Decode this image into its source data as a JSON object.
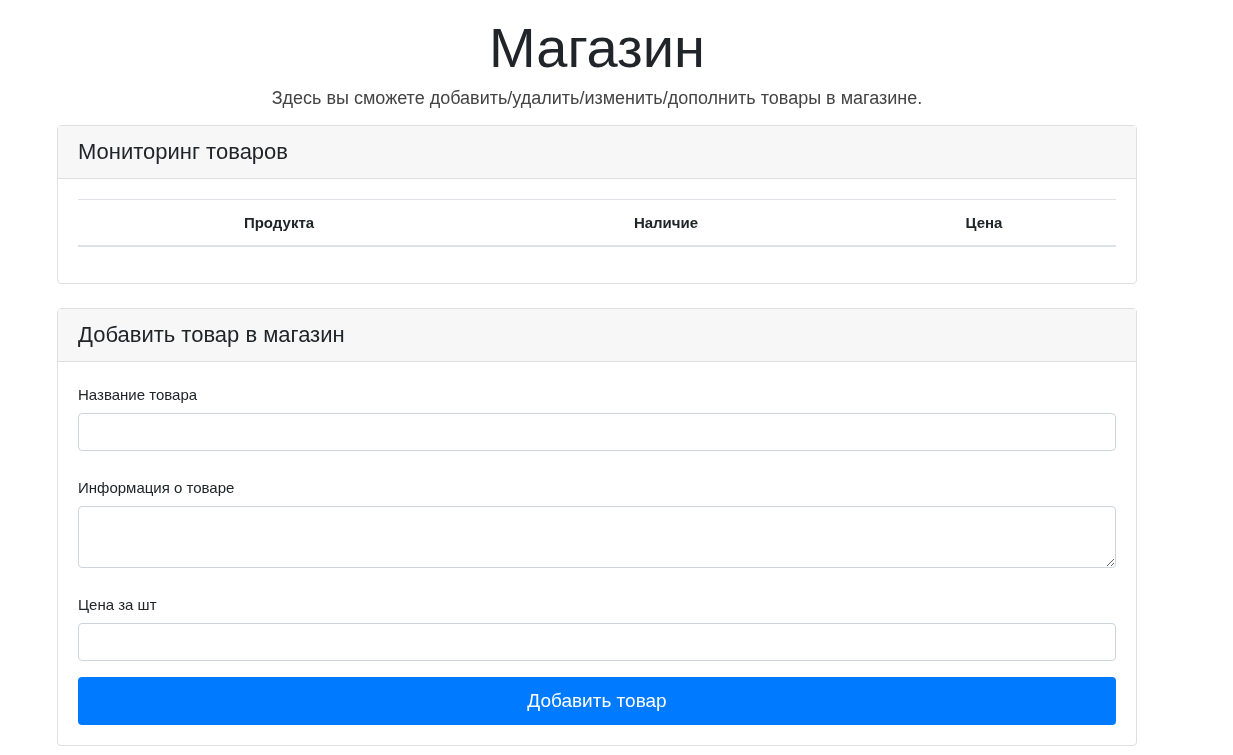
{
  "page": {
    "title": "Магазин",
    "subtitle": "Здесь вы сможете добавить/удалить/изменить/дополнить товары в магазине."
  },
  "monitoring": {
    "title": "Мониторинг товаров",
    "columns": [
      "Продукта",
      "Наличие",
      "Цена"
    ]
  },
  "add_form": {
    "title": "Добавить товар в магазин",
    "fields": [
      {
        "label": "Название товара",
        "kind": "input"
      },
      {
        "label": "Информация о товаре",
        "kind": "textarea"
      },
      {
        "label": "Цена за шт",
        "kind": "input"
      }
    ],
    "submit": "Добавить товар"
  }
}
